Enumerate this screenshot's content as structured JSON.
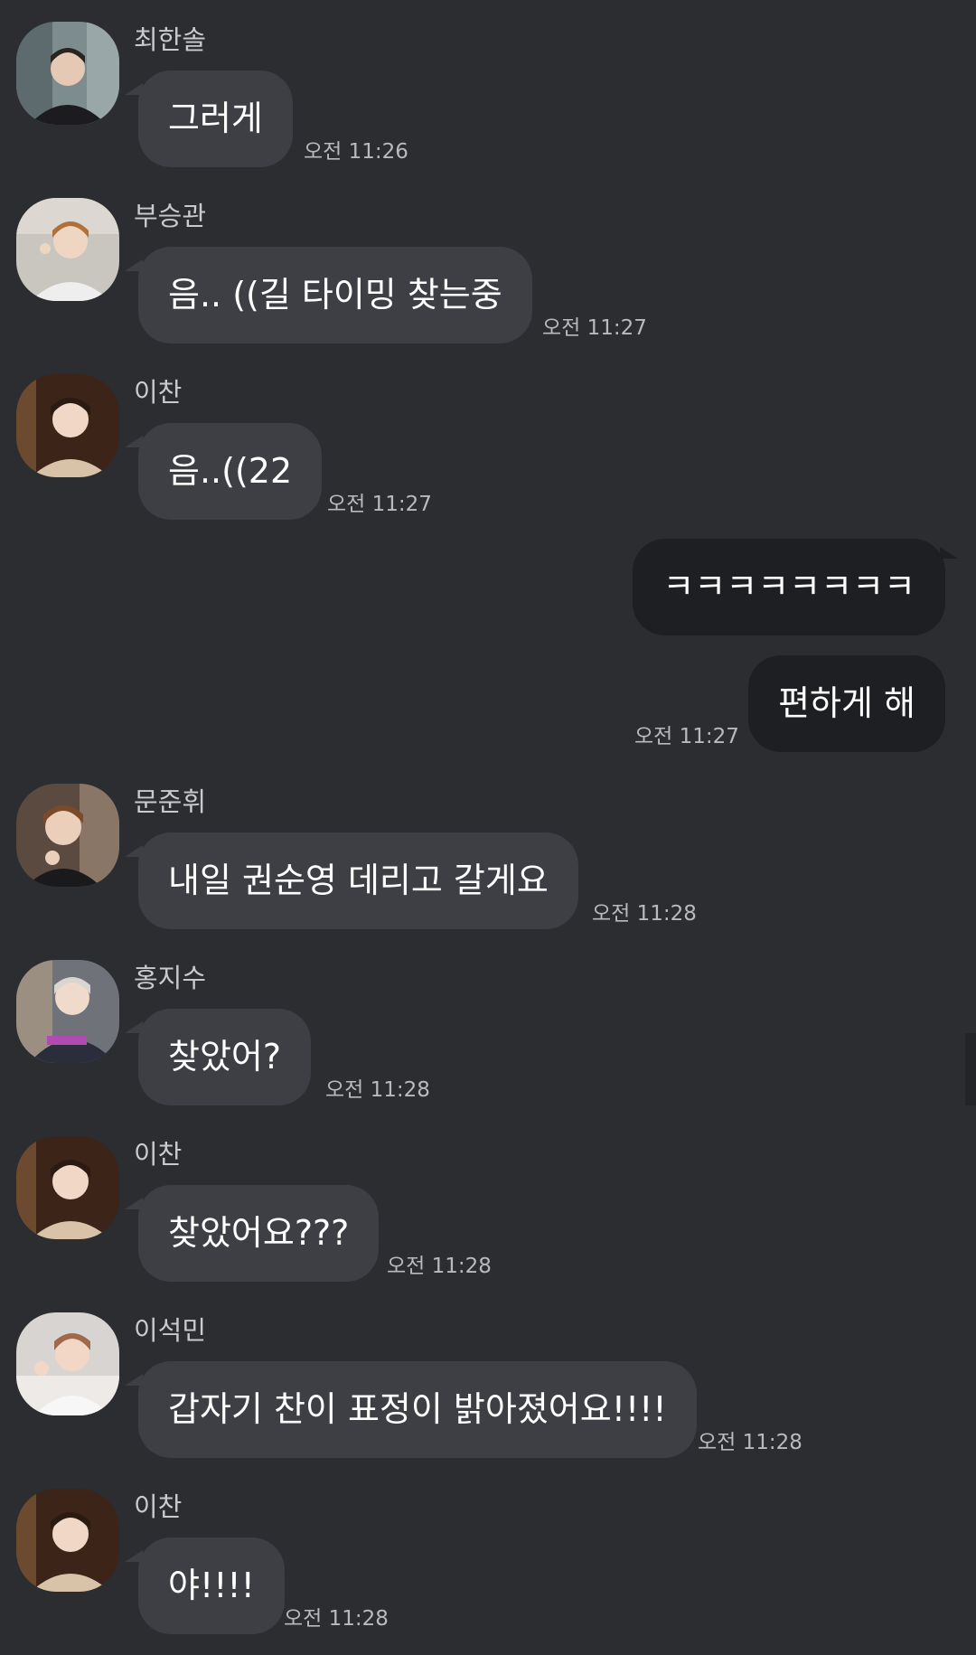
{
  "messages": [
    {
      "sender": "최한솔",
      "text": "그러게",
      "time": "오전 11:26"
    },
    {
      "sender": "부승관",
      "text": "음.. ((길 타이밍 찾는중",
      "time": "오전 11:27"
    },
    {
      "sender": "이찬",
      "text": "음..((22",
      "time": "오전 11:27"
    },
    {
      "text": "ㅋㅋㅋㅋㅋㅋㅋㅋ"
    },
    {
      "text": "편하게 해",
      "time": "오전 11:27"
    },
    {
      "sender": "문준휘",
      "text": "내일 권순영 데리고 갈게요",
      "time": "오전 11:28"
    },
    {
      "sender": "홍지수",
      "text": "찾았어?",
      "time": "오전 11:28"
    },
    {
      "sender": "이찬",
      "text": "찾았어요???",
      "time": "오전 11:28"
    },
    {
      "sender": "이석민",
      "text": "갑자기 찬이 표정이 밝아졌어요!!!!",
      "time": "오전 11:28"
    },
    {
      "sender": "이찬",
      "text": "야!!!!",
      "time": "오전 11:28"
    }
  ],
  "colors": {
    "background": "#2b2d31",
    "incoming_bubble": "#3d3f44",
    "outgoing_bubble": "#1e1f22"
  }
}
